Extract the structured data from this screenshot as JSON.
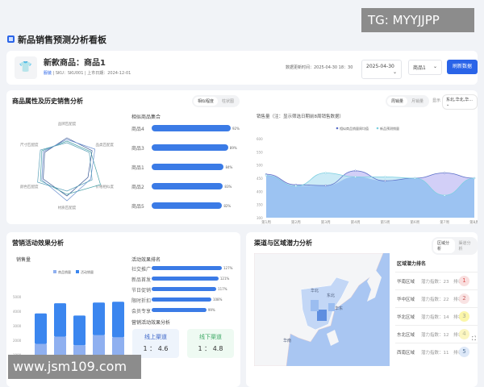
{
  "watermarks": {
    "top": "TG: MYYJJPP",
    "bottom": "www.jsm109.com"
  },
  "page": {
    "title": "新品销售预测分析看板",
    "icon": "dashboard-icon"
  },
  "header": {
    "product_name": "新款商品：商品1",
    "category": "服装",
    "meta": " | SKU：SKU001 | 上市日期：2024-12-01",
    "update_time": "数据更新时间：2025-04-30 18：30",
    "date_select": "2025-04-30",
    "product_select": "商品1",
    "refresh_label": "刷新数据",
    "accent": "#2a64e8"
  },
  "attr_panel": {
    "title": "商品属性及历史销售分析",
    "tabs": [
      "相似程度",
      "柱状图"
    ],
    "radar": {
      "axes": [
        "品牌匹配度",
        "品类匹配度",
        "价格相似度",
        "材质匹配度",
        "颜色匹配度",
        "尺寸匹配度"
      ]
    },
    "similar": {
      "title": "相似商品集合",
      "items": [
        {
          "name": "商品4",
          "value": 92,
          "label": "92%"
        },
        {
          "name": "商品3",
          "value": 89,
          "label": "89%"
        },
        {
          "name": "商品1",
          "value": 84,
          "label": "84%"
        },
        {
          "name": "商品2",
          "value": 83,
          "label": "83%"
        },
        {
          "name": "商品5",
          "value": 82,
          "label": "82%"
        }
      ]
    }
  },
  "sales_panel": {
    "tabs": [
      "周销量",
      "月销量"
    ],
    "filter_label": "显示",
    "filter_value": "东北,华北,华..."
  },
  "chart_data": [
    {
      "type": "area",
      "title": "销售量（注：显示筛选日期前8周销售数据）",
      "categories": [
        "第1周",
        "第2周",
        "第3周",
        "第4周",
        "第5周",
        "第6周",
        "第7周",
        "第8周"
      ],
      "ylim": [
        300,
        600
      ],
      "yticks": [
        300,
        350,
        400,
        450,
        500,
        550,
        600
      ],
      "series": [
        {
          "name": "相似商品销量周均值",
          "values": [
            465,
            425,
            422,
            478,
            440,
            450,
            470,
            450
          ],
          "color": "#5b6fc8"
        },
        {
          "name": "新品预测销量",
          "values": [
            460,
            420,
            470,
            455,
            455,
            450,
            385,
            450
          ],
          "color": "#7ccfe0"
        }
      ],
      "legend": "top"
    },
    {
      "type": "bar",
      "stacked": true,
      "title": "销售量",
      "ylim": [
        0,
        5000
      ],
      "yticks": [
        0,
        1000,
        2000,
        3000,
        4000,
        5000
      ],
      "series": [
        {
          "name": "商品销量",
          "values": [
            1750,
            2250,
            1650,
            2350,
            2200
          ],
          "color": "#8fb0f0"
        },
        {
          "name": "活动销量",
          "values": [
            2100,
            2300,
            2050,
            2250,
            2450
          ],
          "color": "#3b86ef"
        }
      ],
      "legend": "top"
    }
  ],
  "marketing": {
    "title": "营销活动效果分析",
    "ranking_title": "活动效果排名",
    "ranking": [
      {
        "name": "社交推广",
        "value": 127,
        "label": "127%"
      },
      {
        "name": "新品首发",
        "value": 121,
        "label": "121%"
      },
      {
        "name": "节日促销",
        "value": 117,
        "label": "117%"
      },
      {
        "name": "限时折扣",
        "value": 108,
        "label": "108%"
      },
      {
        "name": "会员专享",
        "value": 99,
        "label": "99%"
      }
    ],
    "effect_title": "营销活动效果分析",
    "online": {
      "label": "线上渠道",
      "ratio": "1 ： 4.6"
    },
    "offline": {
      "label": "线下渠道",
      "ratio": "1 ： 4.8"
    }
  },
  "region": {
    "title": "渠道与区域潜力分析",
    "tabs": [
      "区域分析",
      "渠道分析"
    ],
    "map_labels": [
      "东北",
      "华北",
      "华东",
      "华南"
    ],
    "ranking_title": "区域潜力排名",
    "rows": [
      {
        "name": "华南区域",
        "index": "潜力指数：23",
        "rank_label": "排名",
        "rank": "1",
        "color": "#f9dede",
        "fg": "#d55"
      },
      {
        "name": "华中区域",
        "index": "潜力指数：22",
        "rank_label": "排名",
        "rank": "2",
        "color": "#f9e3e3",
        "fg": "#c66"
      },
      {
        "name": "华北区域",
        "index": "潜力指数：14",
        "rank_label": "排名",
        "rank": "3",
        "color": "#fbf6a8",
        "fg": "#aa9"
      },
      {
        "name": "东北区域",
        "index": "潜力指数：12",
        "rank_label": "排名",
        "rank": "4",
        "color": "#fbf6c0",
        "fg": "#bb9"
      },
      {
        "name": "西南区域",
        "index": "潜力指数：11",
        "rank_label": "排名",
        "rank": "5",
        "color": "#dde8f8",
        "fg": "#579"
      }
    ]
  }
}
